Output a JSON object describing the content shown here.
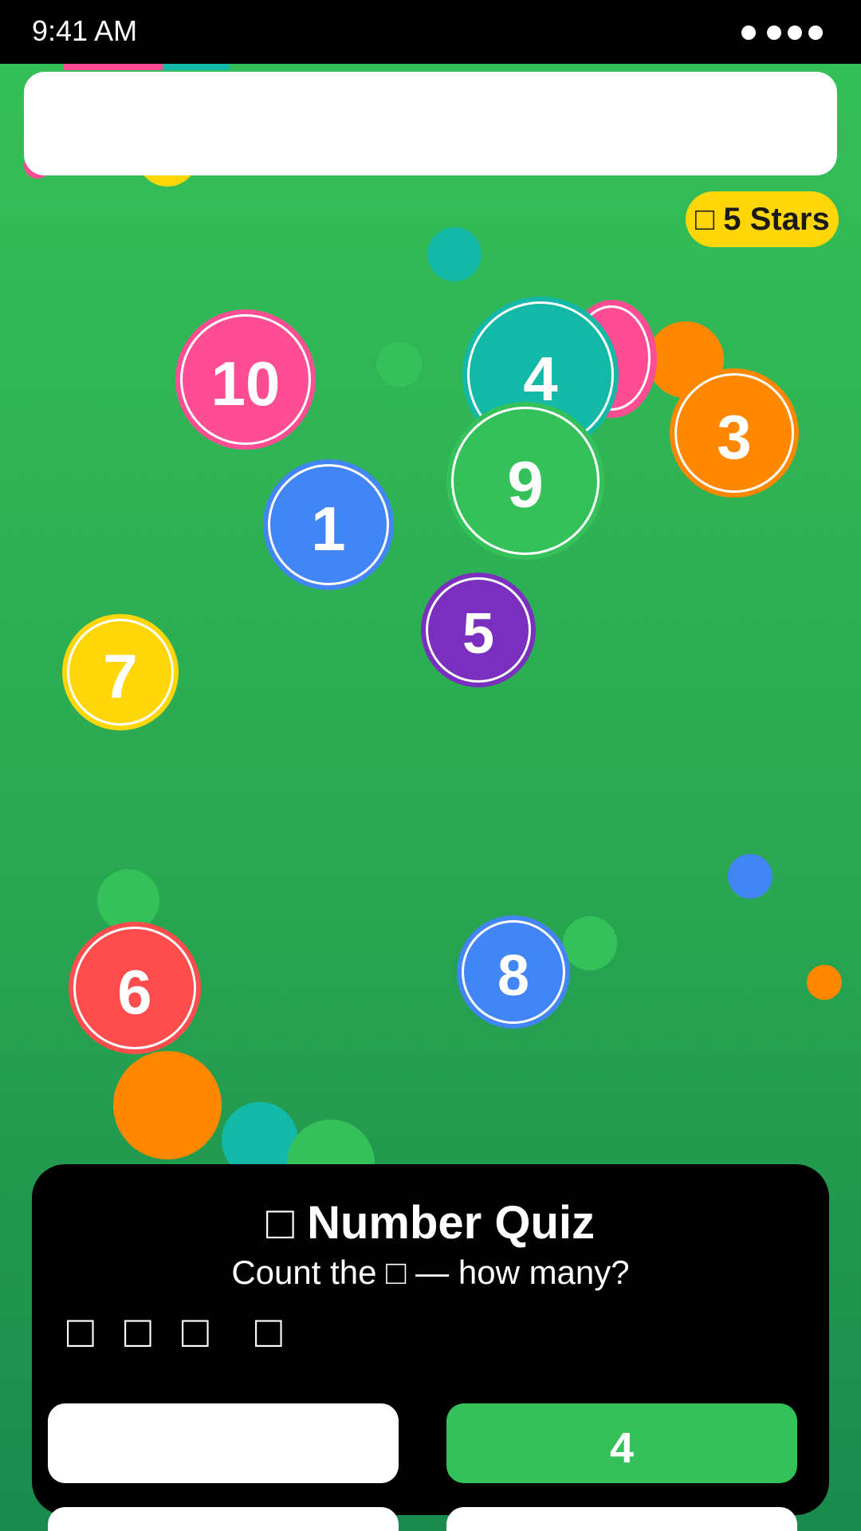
{
  "status_bar": {
    "time": "9:41 AM"
  },
  "top_bar": {
    "stars_icon": "star-icon",
    "stars_label": "□ 5 Stars"
  },
  "bubbles": [
    {
      "number": "10",
      "color": "#ff4d94"
    },
    {
      "number": "4",
      "color": "#14b8a6"
    },
    {
      "number": "3",
      "color": "#ff8800"
    },
    {
      "number": "9",
      "color": "#35c159"
    },
    {
      "number": "1",
      "color": "#4285f4"
    },
    {
      "number": "5",
      "color": "#7b2fbe"
    },
    {
      "number": "7",
      "color": "#ffd60a"
    },
    {
      "number": "6",
      "color": "#ff4d4d"
    },
    {
      "number": "8",
      "color": "#4285f4"
    }
  ],
  "quiz": {
    "title": "□ Number Quiz",
    "question": "Count the □ — how many?",
    "items": [
      "□",
      "□",
      "□",
      "□"
    ],
    "answers": [
      {
        "label": ""
      },
      {
        "label": "4"
      },
      {
        "label": ""
      },
      {
        "label": ""
      }
    ]
  },
  "colors": {
    "background_top": "#35c159",
    "background_bottom": "#198a4d",
    "pink": "#ff4d94",
    "teal": "#14b8a6",
    "orange": "#ff8800",
    "green": "#35c159",
    "blue": "#4285f4",
    "purple": "#7b2fbe",
    "yellow": "#ffd60a",
    "red": "#ff4d4d"
  }
}
